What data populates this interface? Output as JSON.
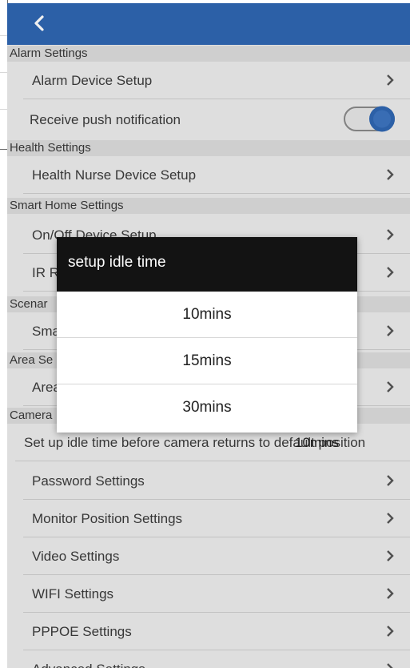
{
  "header": {
    "back_icon": "chevron-left-icon",
    "bar_color": "#2f66b2"
  },
  "sections": {
    "alarm": "Alarm Settings",
    "health": "Health Settings",
    "smarthome": "Smart Home Settings",
    "scenario": "Scenar",
    "area": "Area Se",
    "camera": "Camera"
  },
  "rows": {
    "alarm_device": "Alarm Device Setup",
    "push": "Receive push notification",
    "health_nurse": "Health Nurse Device Setup",
    "onoff": "On/Off Device Setup",
    "ir_remote": "IR Remote-ctrl Setup",
    "smart": "Sma",
    "area": "Area",
    "idle_time": "Set up idle time before camera returns to default position",
    "idle_value": "10mins",
    "password": "Password Settings",
    "monitor": "Monitor Position Settings",
    "video": "Video Settings",
    "wifi": "WIFI Settings",
    "pppoe": "PPPOE Settings",
    "advanced": "Advanced Settings"
  },
  "push_toggle": {
    "on": true,
    "color": "#2f66b2"
  },
  "dialog": {
    "title": "setup idle time",
    "options": [
      "10mins",
      "15mins",
      "30mins"
    ]
  }
}
